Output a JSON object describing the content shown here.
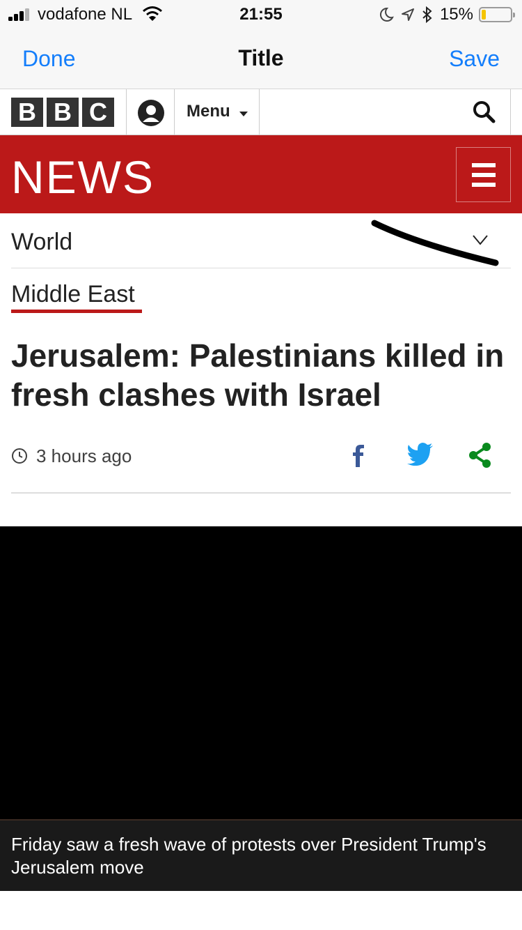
{
  "status_bar": {
    "carrier": "vodafone NL",
    "time": "21:55",
    "battery_percent": "15%",
    "battery_level": 0.15,
    "signal_bars": 3
  },
  "nav_bar": {
    "done_label": "Done",
    "title": "Title",
    "save_label": "Save",
    "accent_color": "#147efb"
  },
  "bbc_bar": {
    "logo_letters": [
      "B",
      "B",
      "C"
    ],
    "menu_label": "Menu"
  },
  "news_band": {
    "wordmark": "NEWS",
    "brand_color": "#bb1919"
  },
  "section_nav": {
    "section": "World",
    "subsection": "Middle East"
  },
  "article": {
    "headline": "Jerusalem: Palestinians killed in fresh clashes with Israel",
    "timestamp": "3 hours ago",
    "share_icons": [
      "facebook-icon",
      "twitter-icon",
      "share-icon"
    ]
  },
  "media": {
    "caption": "Friday saw a fresh wave of protests over President Trump's Jerusalem move"
  }
}
